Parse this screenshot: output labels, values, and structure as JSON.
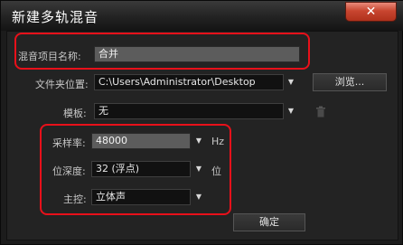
{
  "window": {
    "title": "新建多轨混音",
    "close_label": "✕"
  },
  "session_name": {
    "label": "混音项目名称:",
    "value": "合并"
  },
  "folder_location": {
    "label": "文件夹位置:",
    "value": "C:\\Users\\Administrator\\Desktop",
    "browse_label": "浏览..."
  },
  "template": {
    "label": "模板:",
    "value": "无"
  },
  "sample_rate": {
    "label": "采样率:",
    "value": "48000",
    "unit": "Hz"
  },
  "bit_depth": {
    "label": "位深度:",
    "value": "32 (浮点)",
    "unit": "位"
  },
  "master": {
    "label": "主控:",
    "value": "立体声"
  },
  "ok_button": "确定",
  "colors": {
    "highlight": "#e8101a",
    "close_button": "#c84630"
  }
}
